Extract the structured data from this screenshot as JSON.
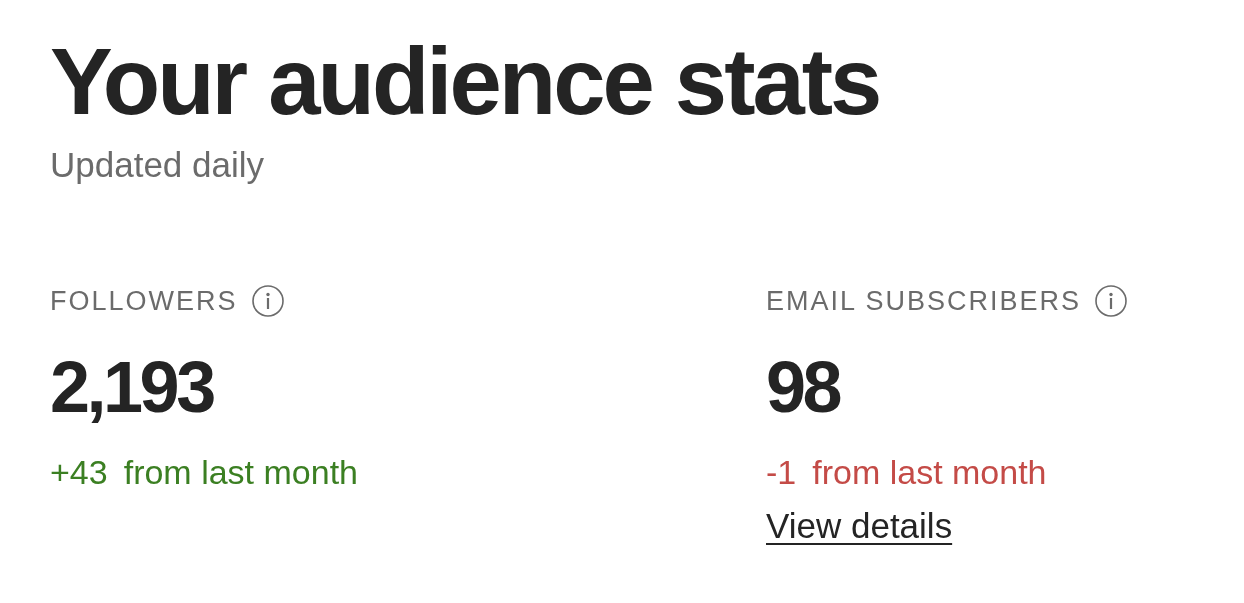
{
  "page": {
    "title": "Your audience stats",
    "subtitle": "Updated daily"
  },
  "stats": [
    {
      "label": "FOLLOWERS",
      "info": true,
      "value": "2,193",
      "delta": "+43",
      "delta_caption": "from last month",
      "color": "#3b7f22"
    },
    {
      "label": "EMAIL SUBSCRIBERS",
      "info": true,
      "value": "98",
      "delta": "-1",
      "delta_caption": "from last month",
      "color": "#c44b47",
      "link": "View details"
    }
  ]
}
